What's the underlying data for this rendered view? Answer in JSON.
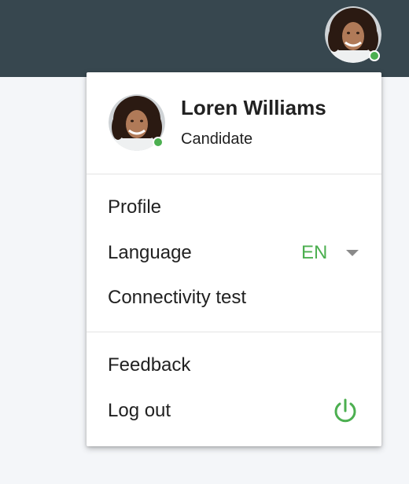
{
  "header": {
    "avatar_icon": "user-avatar",
    "status": "online"
  },
  "menu": {
    "user": {
      "name": "Loren Williams",
      "role": "Candidate"
    },
    "items": [
      {
        "label": "Profile"
      },
      {
        "label": "Language",
        "value": "EN",
        "icon": "chevron-down-icon"
      },
      {
        "label": "Connectivity test"
      },
      {
        "label": "Feedback"
      },
      {
        "label": "Log out",
        "icon": "power-icon"
      }
    ]
  },
  "colors": {
    "header_bg": "#37474f",
    "accent": "#4caf50",
    "status_online": "#4caf50"
  }
}
